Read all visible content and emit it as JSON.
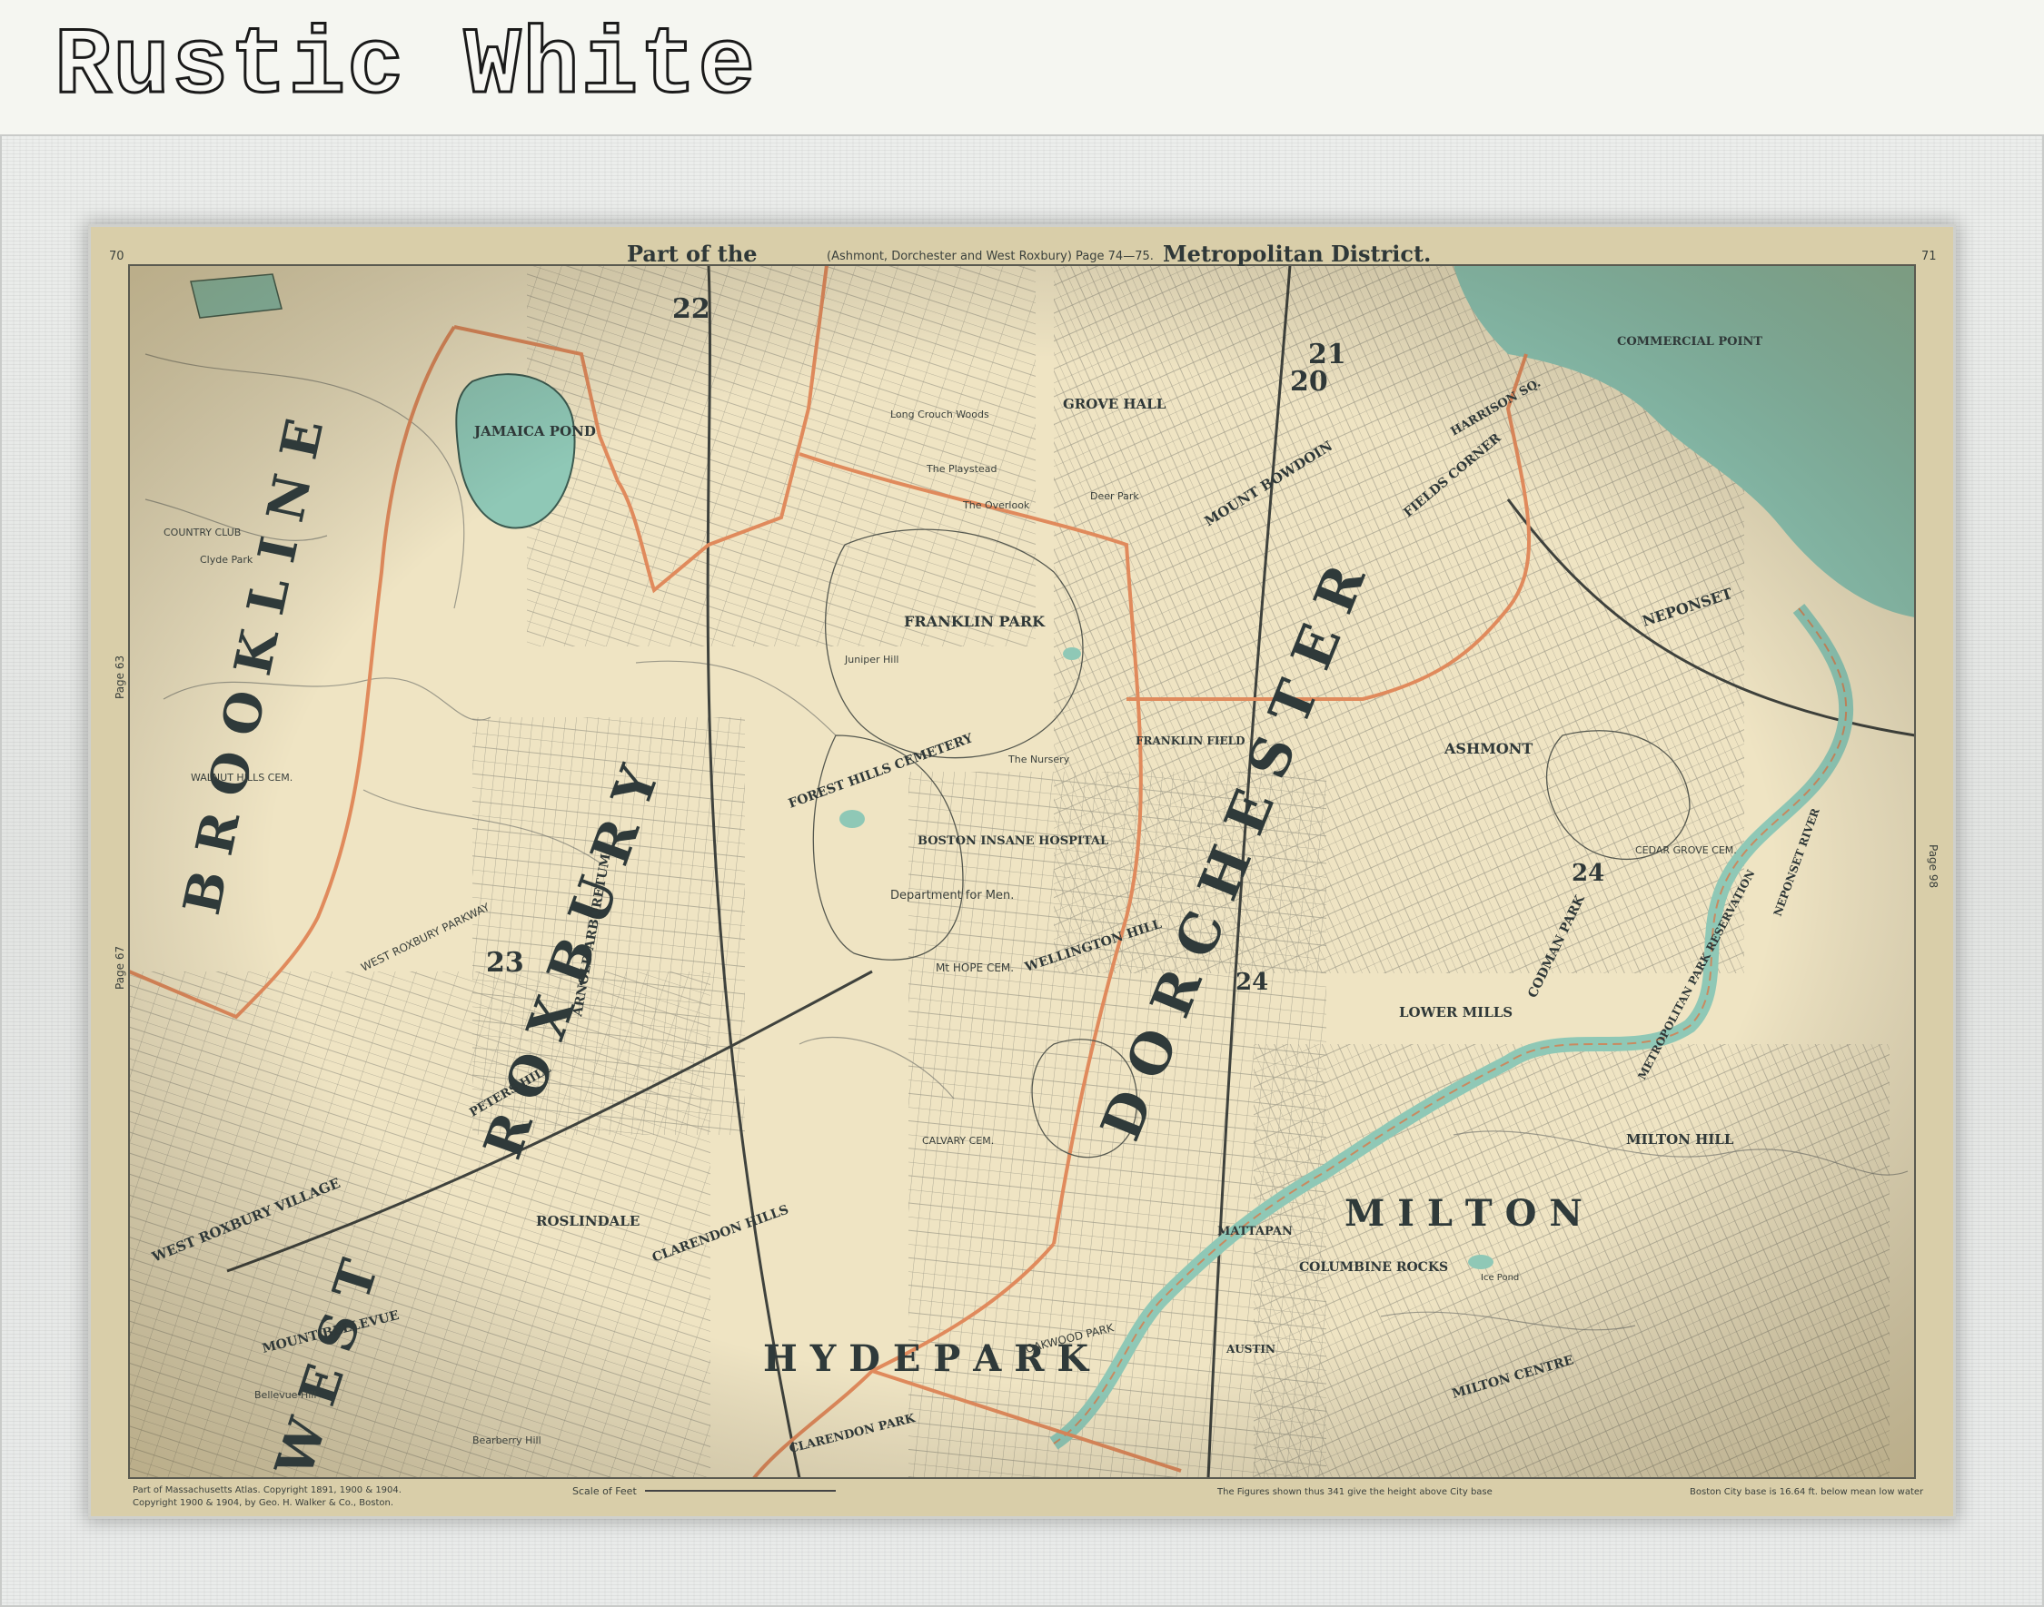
{
  "banner": {
    "title": "Rustic White"
  },
  "map": {
    "header": {
      "part_of_the": "Part of the",
      "subtitle": "(Ashmont, Dorchester and West Roxbury) Page 74—75.",
      "district": "Metropolitan District.",
      "page_left": "70",
      "page_right": "71"
    },
    "side_pages": {
      "left_upper": "Page 63",
      "left_lower": "Page 67",
      "right": "Page 98"
    },
    "footer": {
      "left_line1": "Part of Massachusetts Atlas. Copyright 1891, 1900 & 1904.",
      "left_line2": "Copyright 1900 & 1904, by Geo. H. Walker & Co., Boston.",
      "scale": "Scale of Feet",
      "figures_note": "The Figures shown thus 341 give the height above City base",
      "base_note": "Boston City base is 16.64 ft. below mean low water"
    },
    "regions": {
      "brookline": "B R O O K L I N E",
      "roxbury": "R O X B U R Y",
      "west": "W E S T",
      "dorchester": "D O R C H E S T E R",
      "hyde_park": "H Y D E   P A R K",
      "milton": "M I L T O N"
    },
    "places": {
      "jamaica_pond": "JAMAICA POND",
      "franklin_park": "FRANKLIN PARK",
      "forest_hills_cemetery": "FOREST HILLS CEMETERY",
      "boston_insane_hospital": "BOSTON INSANE HOSPITAL",
      "department_for_men": "Department for Men.",
      "mt_hope_cem": "Mt HOPE CEM.",
      "calvary_cem": "CALVARY CEM.",
      "wellington_hill": "WELLINGTON HILL",
      "franklin_field": "FRANKLIN FIELD",
      "ashmont": "ASHMONT",
      "lower_mills": "LOWER MILLS",
      "milton_hill": "MILTON HILL",
      "neponset": "NEPONSET",
      "commercial_point": "COMMERCIAL POINT",
      "cedar_grove_cem": "CEDAR GROVE CEM.",
      "metropolitan_park": "METROPOLITAN PARK RESERVATION",
      "neponset_river": "NEPONSET RIVER",
      "roslindale": "ROSLINDALE",
      "clarendon_hills": "CLARENDON HILLS",
      "west_roxbury_village": "WEST ROXBURY VILLAGE",
      "mount_bellevue": "MOUNT BELLEVUE",
      "bellevue_hill": "Bellevue Hill",
      "bearberry_hill": "Bearberry Hill",
      "columbine_rocks": "COLUMBINE ROCKS",
      "milton_centre": "MILTON CENTRE",
      "mattapan": "MATTAPAN",
      "codman_park": "CODMAN PARK",
      "arnold_arboretum": "ARNOLD ARBORETUM",
      "walnut_hills_cem": "WALNUT HILLS CEM.",
      "country_club": "COUNTRY CLUB",
      "clyde_park": "Clyde Park",
      "grove_hall": "GROVE HALL",
      "mount_bowdoin": "MOUNT BOWDOIN",
      "fields_corner": "FIELDS CORNER",
      "harrison_sq": "HARRISON SQ.",
      "peters_hill": "PETERS HILL",
      "west_roxbury_parkway": "WEST ROXBURY PARKWAY",
      "oakwood_park": "OAKWOOD PARK",
      "clarendon_park": "CLARENDON PARK",
      "the_playstead": "The Playstead",
      "the_overlook": "The Overlook",
      "long_crouch_woods": "Long Crouch Woods",
      "deer_park": "Deer Park",
      "juniper_hill": "Juniper Hill",
      "the_nursery": "The Nursery",
      "ice_pond": "Ice Pond",
      "austin": "AUSTIN"
    },
    "district_numbers": {
      "n22": "22",
      "n20": "20",
      "n21": "21",
      "n23": "23",
      "n24a": "24",
      "n24b": "24"
    }
  },
  "colors": {
    "paper": "#efe4c3",
    "water": "#8fc8b6",
    "ink": "#2f3838",
    "boundary": "#e08a5c"
  }
}
